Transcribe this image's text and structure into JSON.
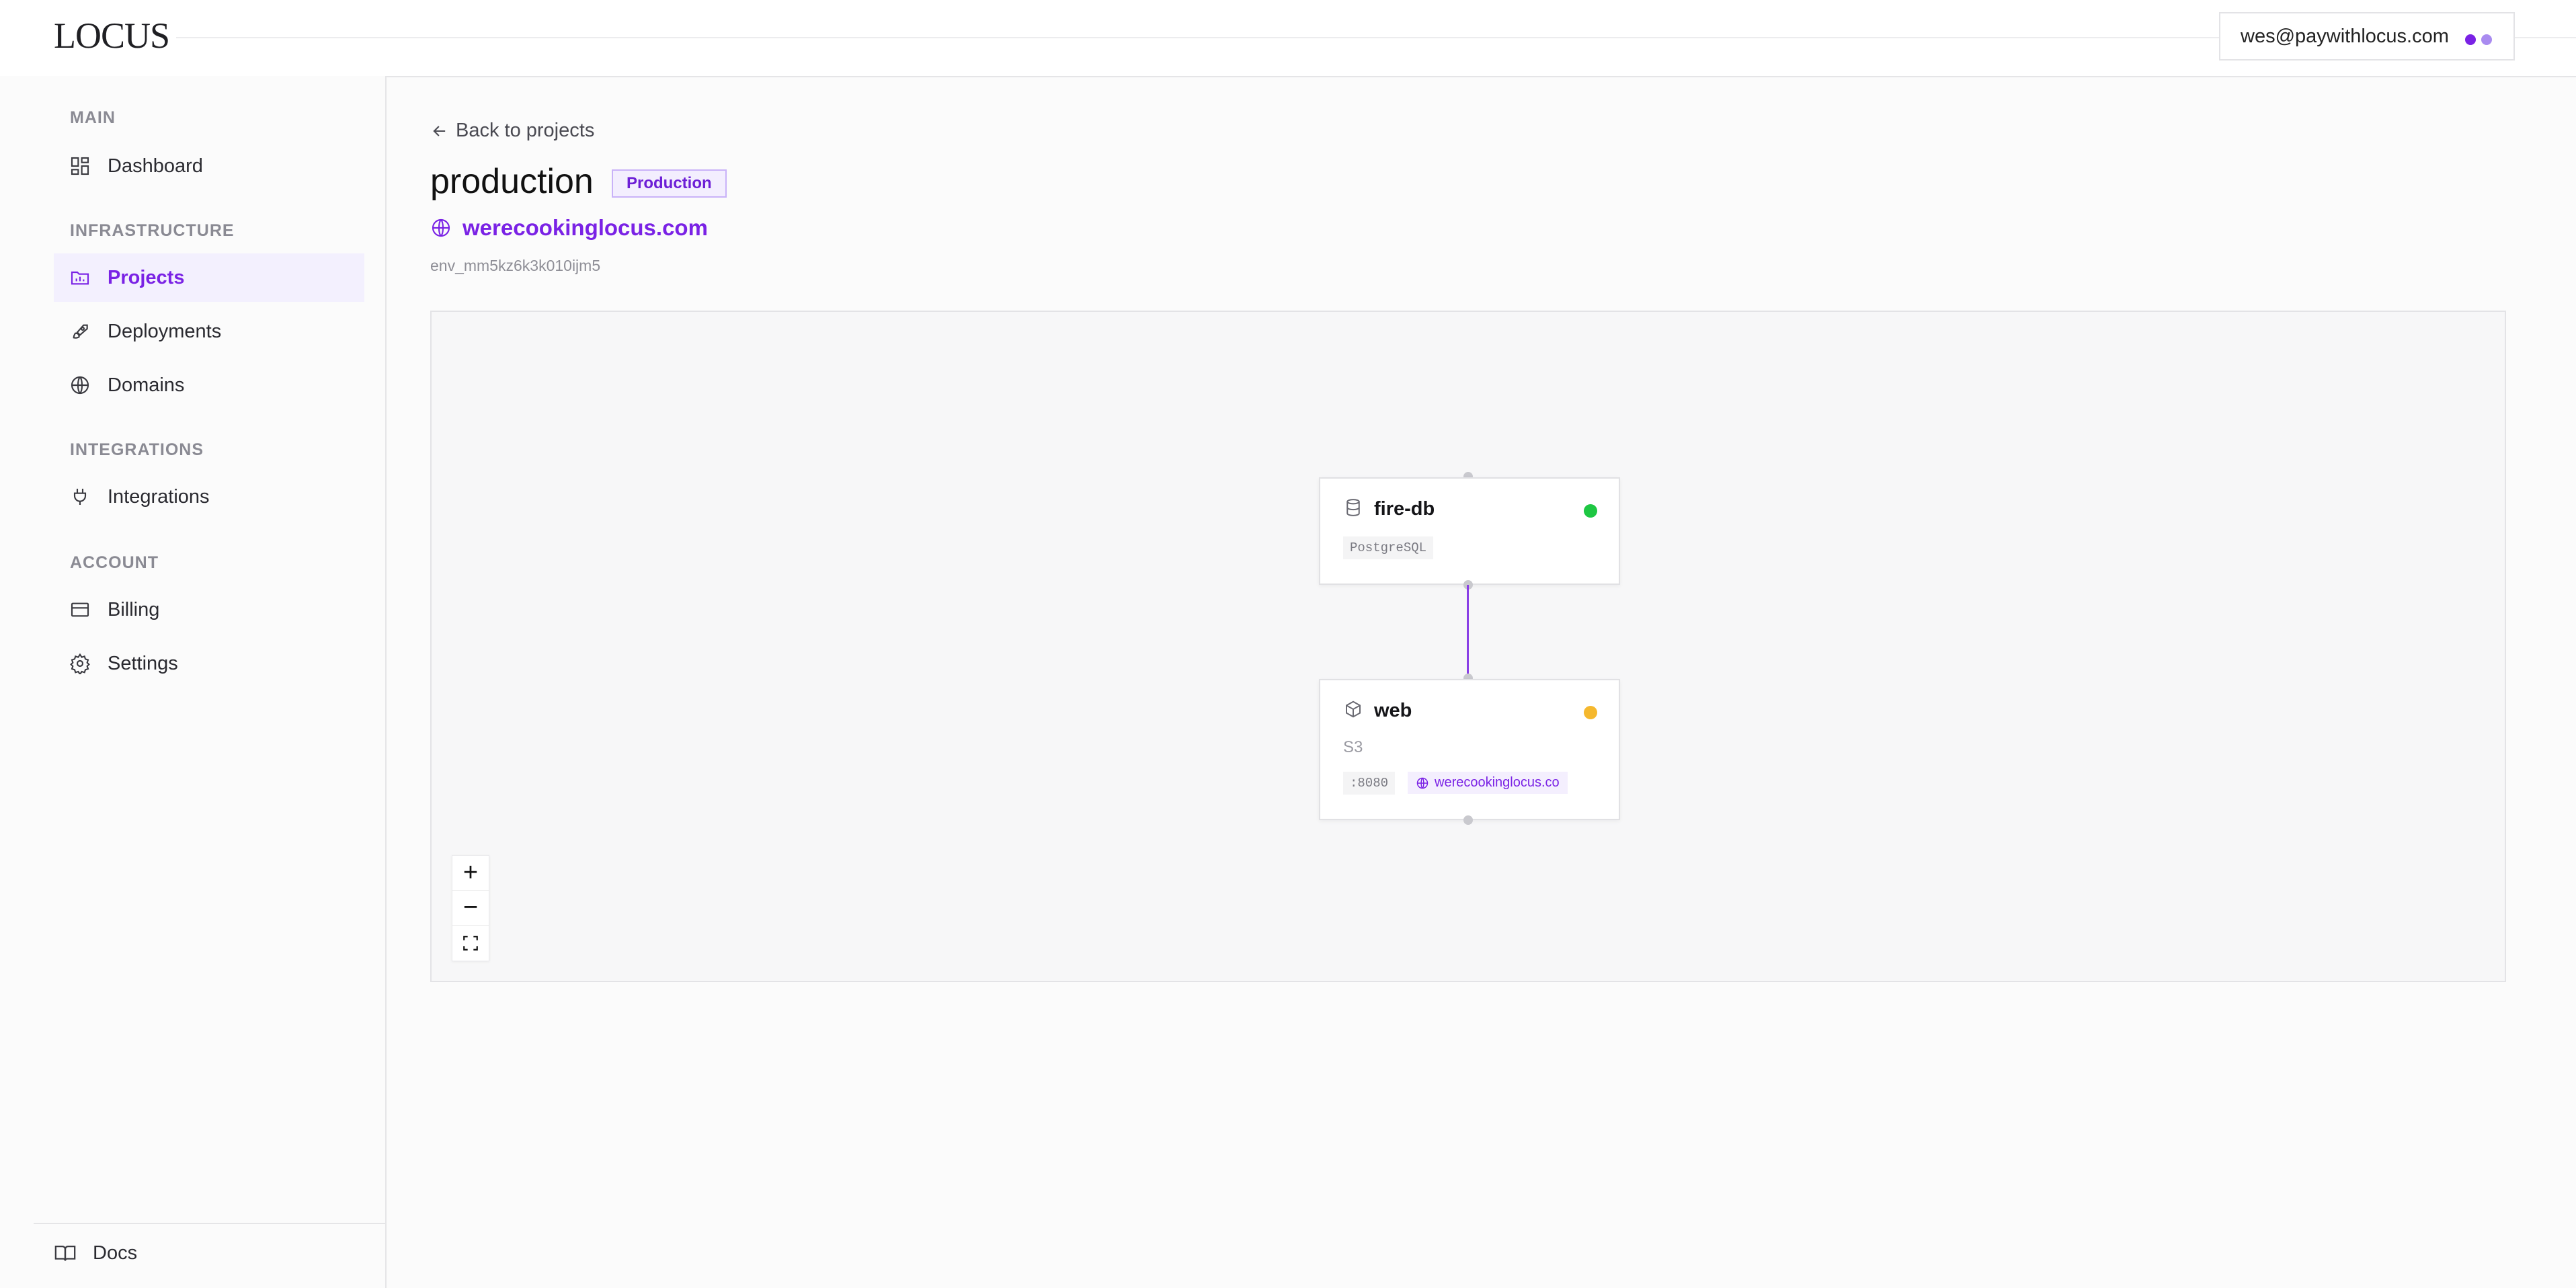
{
  "app": {
    "logo": "LOCUS"
  },
  "header": {
    "user_email": "wes@paywithlocus.com",
    "dot_colors": [
      "#7a22e5",
      "#a98bf0"
    ]
  },
  "sidebar": {
    "sections": [
      {
        "label": "MAIN",
        "items": [
          {
            "label": "Dashboard",
            "icon": "dashboard-icon"
          }
        ]
      },
      {
        "label": "INFRASTRUCTURE",
        "items": [
          {
            "label": "Projects",
            "icon": "folder-icon",
            "active": true
          },
          {
            "label": "Deployments",
            "icon": "rocket-icon"
          },
          {
            "label": "Domains",
            "icon": "globe-icon"
          }
        ]
      },
      {
        "label": "INTEGRATIONS",
        "items": [
          {
            "label": "Integrations",
            "icon": "plug-icon"
          }
        ]
      },
      {
        "label": "ACCOUNT",
        "items": [
          {
            "label": "Billing",
            "icon": "credit-card-icon"
          },
          {
            "label": "Settings",
            "icon": "gear-icon"
          }
        ]
      }
    ],
    "footer": {
      "label": "Docs",
      "icon": "book-icon"
    }
  },
  "main": {
    "back_label": "Back to projects",
    "title": "production",
    "env_badge": "Production",
    "domain": "werecookinglocus.com",
    "env_id": "env_mm5kz6k3k010ijm5"
  },
  "canvas": {
    "nodes": [
      {
        "name": "fire-db",
        "icon": "database-icon",
        "status_color": "#1ec743",
        "tag": "PostgreSQL"
      },
      {
        "name": "web",
        "icon": "cube-icon",
        "status_color": "#f5b82e",
        "subtitle": "S3",
        "port": ":8080",
        "domain_chip": "werecookinglocus.co"
      }
    ],
    "edge_color": "#8a3fe6",
    "zoom_controls": [
      "+",
      "−",
      "fit-view-icon"
    ]
  },
  "colors": {
    "accent": "#7a22e5",
    "active_bg": "#f3f0fe"
  }
}
